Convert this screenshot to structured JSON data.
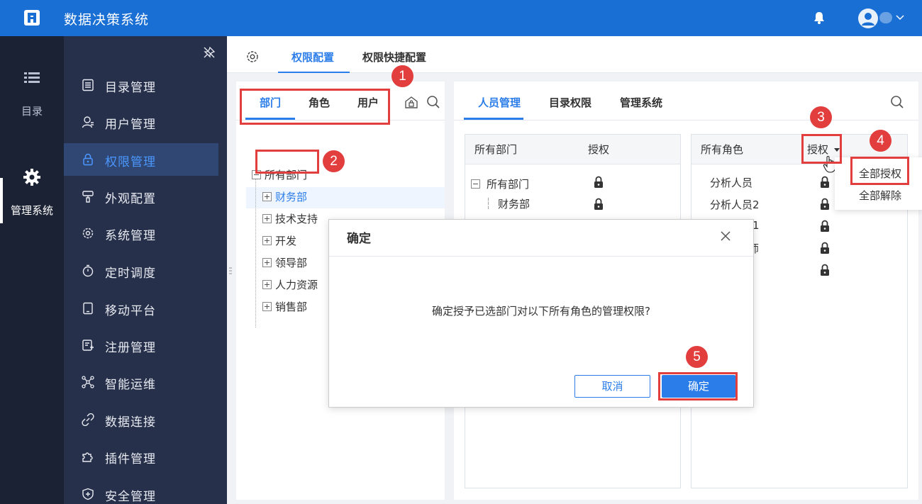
{
  "app": {
    "title": "数据决策系统"
  },
  "rail": {
    "directory": "目录",
    "management": "管理系统"
  },
  "sidenav": {
    "items": [
      {
        "label": "目录管理",
        "icon": "list-doc-icon"
      },
      {
        "label": "用户管理",
        "icon": "user-icon"
      },
      {
        "label": "权限管理",
        "icon": "lock-icon",
        "active": true
      },
      {
        "label": "外观配置",
        "icon": "brush-icon"
      },
      {
        "label": "系统管理",
        "icon": "gear-icon"
      },
      {
        "label": "定时调度",
        "icon": "stopwatch-icon"
      },
      {
        "label": "移动平台",
        "icon": "tablet-icon"
      },
      {
        "label": "注册管理",
        "icon": "register-icon"
      },
      {
        "label": "智能运维",
        "icon": "network-icon"
      },
      {
        "label": "数据连接",
        "icon": "link-icon"
      },
      {
        "label": "插件管理",
        "icon": "puzzle-icon"
      },
      {
        "label": "安全管理",
        "icon": "shield-icon"
      }
    ]
  },
  "tabs": {
    "perm_config": "权限配置",
    "perm_quick": "权限快捷配置"
  },
  "left_panel": {
    "tabs": [
      "部门",
      "角色",
      "用户"
    ],
    "tree": {
      "root": "所有部门",
      "children": [
        "财务部",
        "技术支持",
        "开发",
        "领导部",
        "人力资源",
        "销售部"
      ]
    }
  },
  "right_panel": {
    "tabs": [
      "人员管理",
      "目录权限",
      "管理系统"
    ],
    "dept_box": {
      "header_name": "所有部门",
      "header_auth": "授权",
      "rows": [
        "所有部门",
        "财务部"
      ]
    },
    "role_box": {
      "header_name": "所有角色",
      "header_auth": "授权",
      "rows": [
        "分析人员",
        "分析人员2",
        "1",
        "师",
        ""
      ]
    }
  },
  "dropdown": {
    "grant_all": "全部授权",
    "revoke_all": "全部解除"
  },
  "dialog": {
    "title": "确定",
    "message": "确定授予已选部门对以下所有角色的管理权限?",
    "cancel": "取消",
    "ok": "确定"
  },
  "annotations": [
    "1",
    "2",
    "3",
    "4",
    "5"
  ],
  "colors": {
    "primary": "#2b7de9",
    "topbar": "#1a6fd4",
    "highlight": "#e23e3e",
    "nav_bg": "#27304a",
    "rail_bg": "#1b2233"
  }
}
